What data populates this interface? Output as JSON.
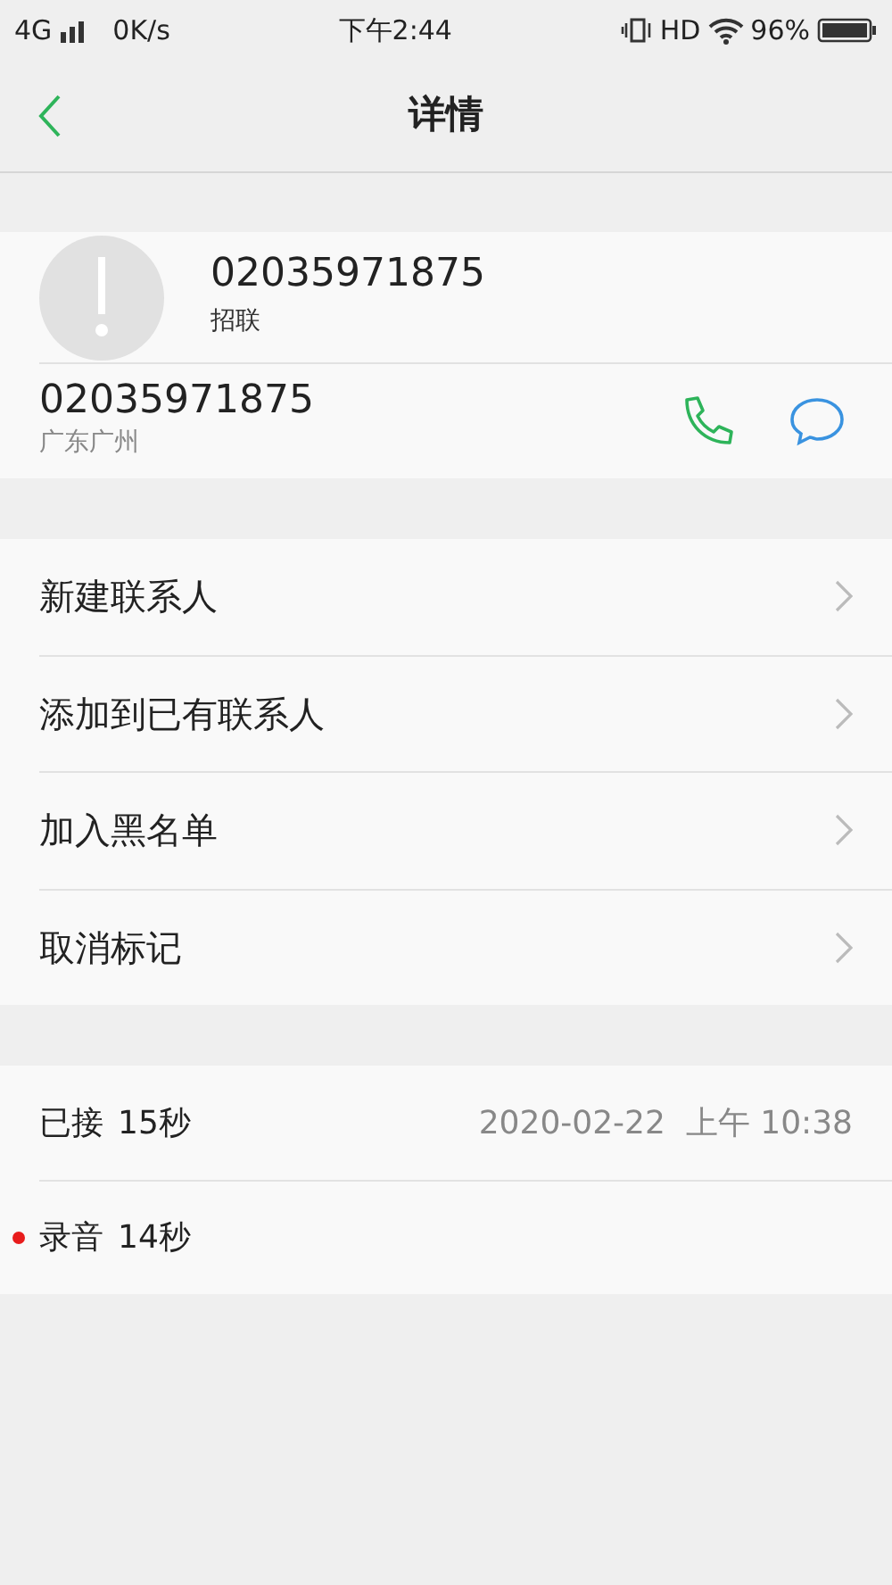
{
  "status_bar": {
    "network": "4G",
    "speed": "0K/s",
    "time": "下午2:44",
    "hd": "HD",
    "battery": "96%"
  },
  "header": {
    "title": "详情"
  },
  "contact": {
    "number": "02035971875",
    "label": "招联"
  },
  "phone": {
    "number": "02035971875",
    "location": "广东广州"
  },
  "actions": [
    {
      "label": "新建联系人"
    },
    {
      "label": "添加到已有联系人"
    },
    {
      "label": "加入黑名单"
    },
    {
      "label": "取消标记"
    }
  ],
  "call_log": [
    {
      "kind": "call",
      "status": "已接",
      "duration": "15秒",
      "datetime": "2020-02-22  上午 10:38"
    },
    {
      "kind": "recording",
      "status": "录音",
      "duration": "14秒"
    }
  ]
}
